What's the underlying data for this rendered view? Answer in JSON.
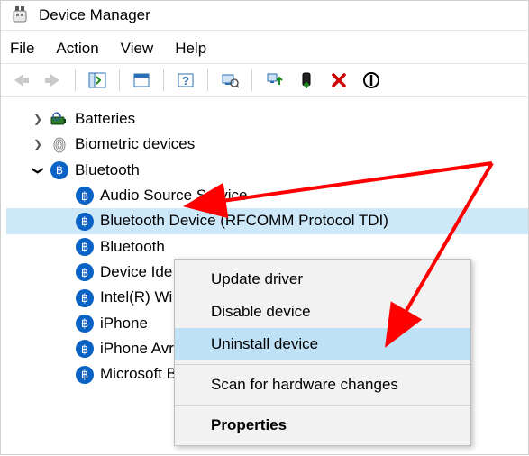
{
  "window_title": "Device Manager",
  "menu": {
    "file": "File",
    "action": "Action",
    "view": "View",
    "help": "Help"
  },
  "tree": {
    "batteries": "Batteries",
    "biometric": "Biometric devices",
    "bluetooth": "Bluetooth",
    "children": {
      "c0": "Audio Source Service",
      "c1": "Bluetooth Device (RFCOMM Protocol TDI)",
      "c2": "Bluetooth",
      "c3": "Device Ide",
      "c4": "Intel(R) Wi",
      "c5": "iPhone",
      "c6": "iPhone Avr",
      "c7": "Microsoft B"
    }
  },
  "context_menu": {
    "update": "Update driver",
    "disable": "Disable device",
    "uninstall": "Uninstall device",
    "scan": "Scan for hardware changes",
    "properties": "Properties"
  }
}
